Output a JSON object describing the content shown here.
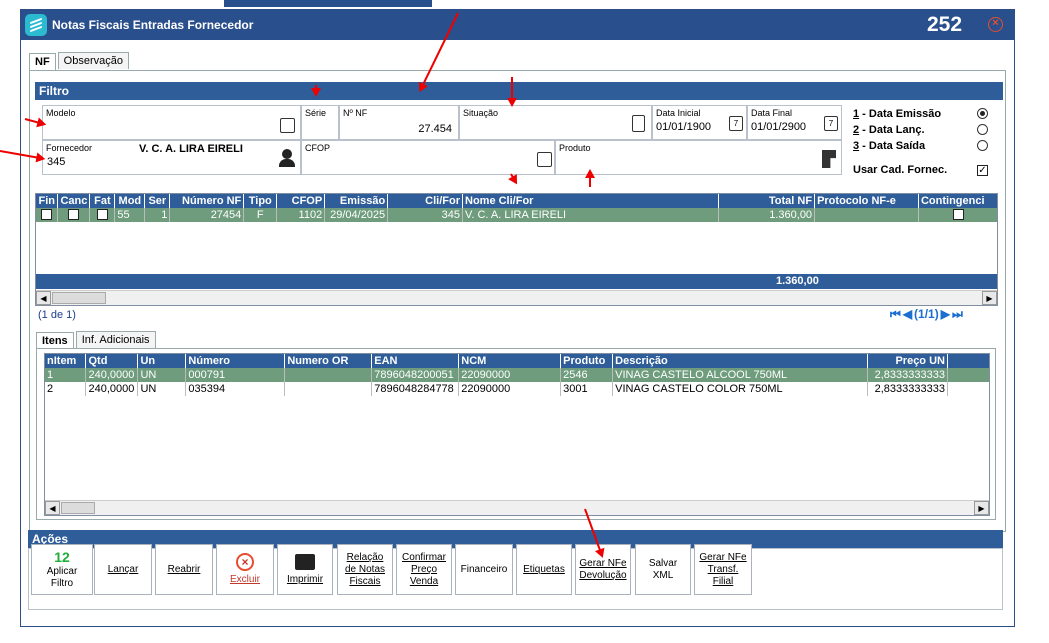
{
  "window": {
    "title": "Notas Fiscais Entradas Fornecedor",
    "number": "252"
  },
  "tabs": [
    "NF",
    "Observação"
  ],
  "filtro": {
    "header": "Filtro",
    "modelo_label": "Modelo",
    "serie_label": "Série",
    "nnf_label": "Nº NF",
    "nnf_value": "27.454",
    "situacao_label": "Situação",
    "data_inicial_label": "Data Inicial",
    "data_inicial_value": "01/01/1900",
    "data_final_label": "Data Final",
    "data_final_value": "01/01/2900",
    "fornecedor_label": "Fornecedor",
    "fornecedor_code": "345",
    "fornecedor_name": "V. C. A. LIRA EIRELI",
    "cfop_label": "CFOP",
    "produto_label": "Produto",
    "radios": [
      {
        "key": "1",
        "label": " - Data Emissão",
        "checked": true
      },
      {
        "key": "2",
        "label": " - Data Lanç.",
        "checked": false
      },
      {
        "key": "3",
        "label": " - Data Saída",
        "checked": false
      }
    ],
    "usar_cad_label": "Usar Cad. Fornec.",
    "usar_cad_checked": true
  },
  "nf_grid": {
    "columns": [
      "Fin",
      "Canc",
      "Fat",
      "Mod",
      "Ser",
      "Número NF",
      "Tipo",
      "CFOP",
      "Emissão",
      "Cli/For",
      "Nome Cli/For",
      "Total NF",
      "Protocolo NF-e",
      "Contingenci"
    ],
    "rows": [
      {
        "fin": "",
        "canc": "",
        "fat": "",
        "mod": "55",
        "ser": "1",
        "numero": "27454",
        "tipo": "F",
        "cfop": "1102",
        "emissao": "29/04/2025",
        "clifor": "345",
        "nome": "V. C. A. LIRA EIRELI",
        "total": "1.360,00",
        "protocolo": "",
        "contingencia": ""
      }
    ],
    "footer_total": "1.360,00",
    "page_info": "(1 de 1)",
    "pager": "(1/1)"
  },
  "sub_tabs": [
    "Itens",
    "Inf. Adicionais"
  ],
  "items_grid": {
    "columns": [
      "nItem",
      "Qtd",
      "Un",
      "Número",
      "Numero OR",
      "EAN",
      "NCM",
      "Produto",
      "Descrição",
      "Preço UN"
    ],
    "rows": [
      {
        "nitem": "1",
        "qtd": "240,0000",
        "un": "UN",
        "numero": "000791",
        "numeroor": "",
        "ean": "7896048200051",
        "ncm": "22090000",
        "produto": "2546",
        "descricao": "VINAG CASTELO ALCOOL 750ML",
        "preco": "2,8333333333"
      },
      {
        "nitem": "2",
        "qtd": "240,0000",
        "un": "UN",
        "numero": "035394",
        "numeroor": "",
        "ean": "7896048284778",
        "ncm": "22090000",
        "produto": "3001",
        "descricao": "VINAG CASTELO COLOR 750ML",
        "preco": "2,8333333333"
      }
    ]
  },
  "acoes": {
    "header": "Ações",
    "buttons": [
      {
        "label": "Aplicar Filtro",
        "icon": "f12-icon"
      },
      {
        "label": "Lançar"
      },
      {
        "label": "Reabrir"
      },
      {
        "label": "Excluir",
        "icon": "cancel-circle-icon"
      },
      {
        "label": "Imprimir",
        "icon": "printer-icon"
      },
      {
        "label": "Relação de Notas Fiscais"
      },
      {
        "label": "Confirmar Preço Venda"
      },
      {
        "label": "Financeiro"
      },
      {
        "label": "Etiquetas"
      },
      {
        "label": "Gerar NFe Devolução"
      },
      {
        "label": "Salvar XML"
      },
      {
        "label": "Gerar NFe Transf. Filial"
      }
    ],
    "f12_text": "12"
  },
  "colors": {
    "header_blue": "#2f5d99",
    "title_blue": "#2a4f8d",
    "selected_row": "#6e9c7d",
    "arrow_red": "#e00000"
  }
}
